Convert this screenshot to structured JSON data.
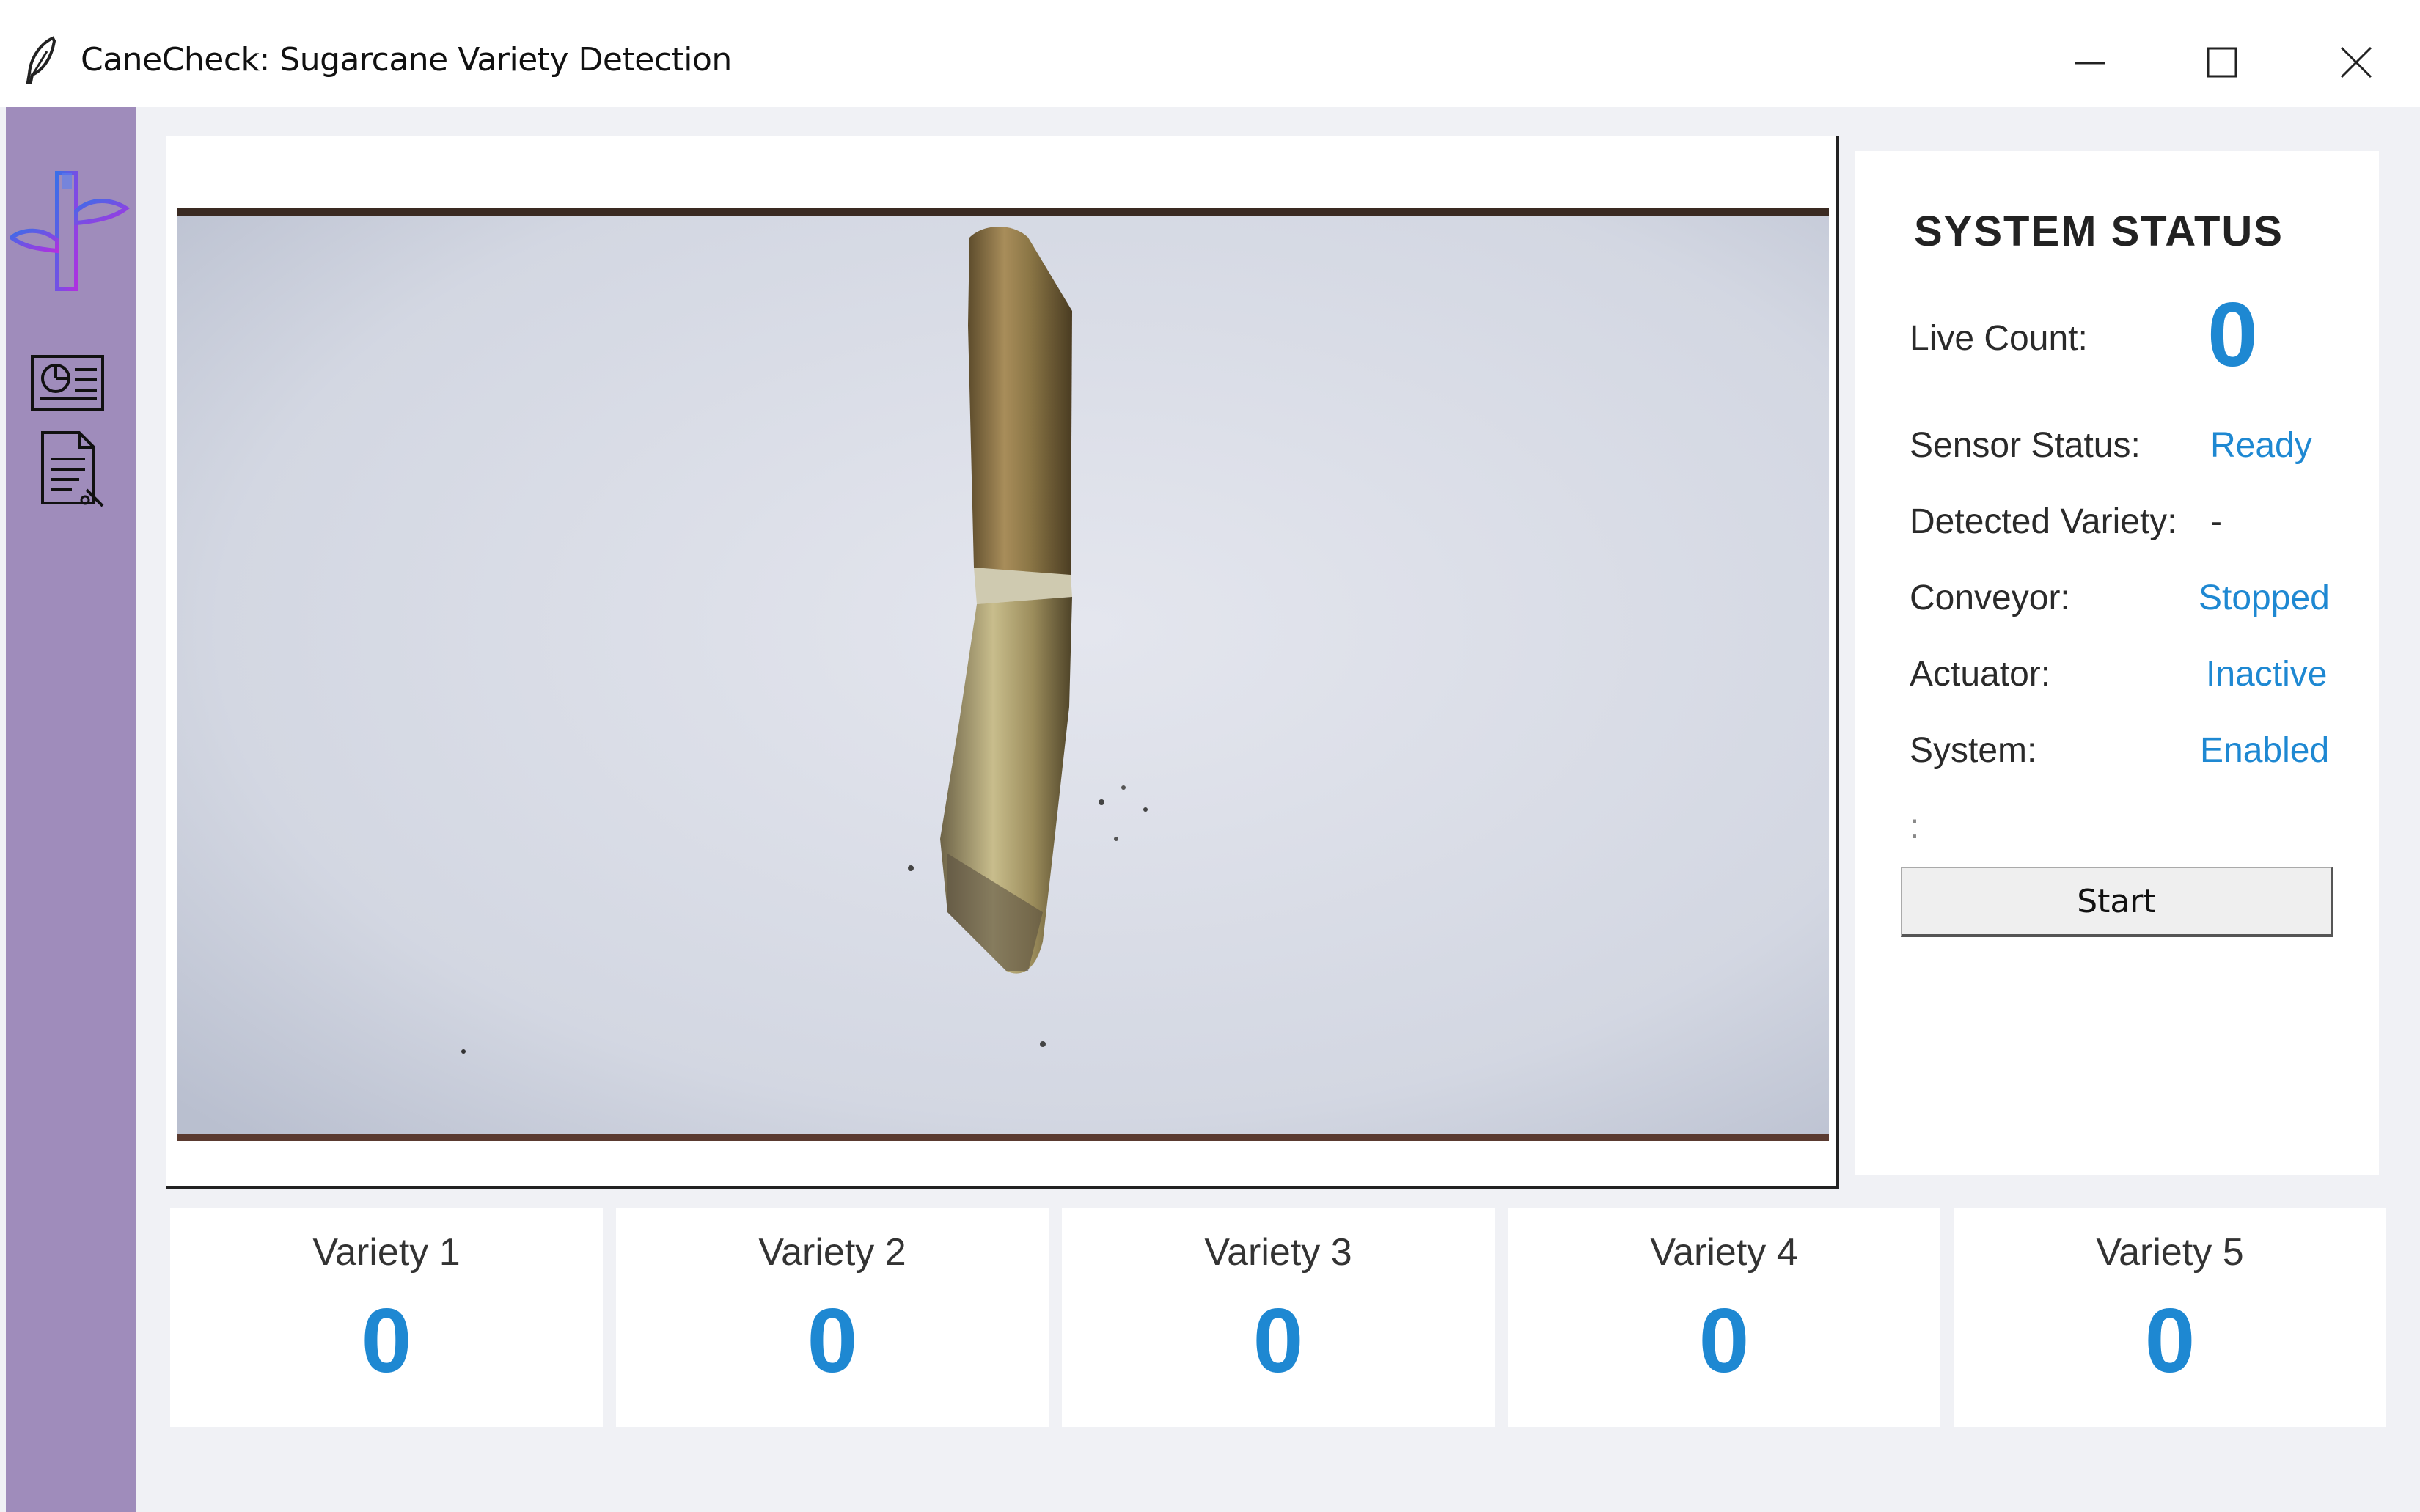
{
  "window": {
    "title": "CaneCheck: Sugarcane Variety Detection",
    "controls": [
      "minimize-icon",
      "maximize-icon",
      "close-icon"
    ]
  },
  "sidebar": {
    "background": "#9f8cbb",
    "items": [
      {
        "name": "sugarcane-logo-icon"
      },
      {
        "name": "dashboard-icon"
      },
      {
        "name": "report-icon"
      }
    ]
  },
  "camera": {
    "subject": "sugarcane-stalk"
  },
  "status": {
    "title": "SYSTEM STATUS",
    "live_count_label": "Live Count:",
    "live_count": "0",
    "sensor_label": "Sensor Status:",
    "sensor_value": "Ready",
    "variety_label": "Detected Variety:",
    "variety_value": "-",
    "conveyor_label": "Conveyor:",
    "conveyor_value": "Stopped",
    "actuator_label": "Actuator:",
    "actuator_value": "Inactive",
    "system_label": "System:",
    "system_value": "Enabled",
    "extra_label": ":",
    "start_button": "Start",
    "accent": "#1e88d2"
  },
  "varieties": [
    {
      "name": "Variety 1",
      "count": "0"
    },
    {
      "name": "Variety 2",
      "count": "0"
    },
    {
      "name": "Variety 3",
      "count": "0"
    },
    {
      "name": "Variety 4",
      "count": "0"
    },
    {
      "name": "Variety 5",
      "count": "0"
    }
  ]
}
